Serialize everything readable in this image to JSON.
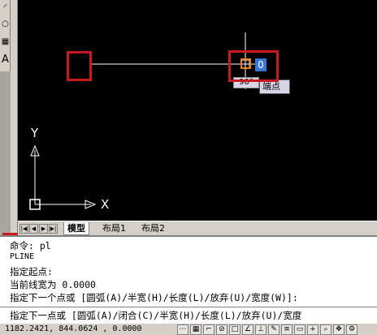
{
  "tools": [
    {
      "icon": "arc-tool-icon",
      "glyph": "◜"
    },
    {
      "icon": "circle-tool-icon",
      "glyph": "○"
    },
    {
      "icon": "hatch-tool-icon",
      "glyph": "▦"
    },
    {
      "icon": "text-tool-icon",
      "glyph": "A"
    }
  ],
  "canvas": {
    "angle_tooltip": "90°",
    "snap_tooltip": "端点",
    "input_value": "0",
    "axis_x": "X",
    "axis_y": "Y"
  },
  "tabs": {
    "nav_buttons": [
      "|◀",
      "◀",
      "▶",
      "▶|"
    ],
    "model": "模型",
    "layout1": "布局1",
    "layout2": "布局2"
  },
  "command_history": [
    "命令: pl",
    "PLINE",
    "指定起点:",
    "当前线宽为 0.0000",
    "指定下一个点或 [圆弧(A)/半宽(H)/长度(L)/放弃(U)/宽度(W)]:"
  ],
  "command_prompt": "指定下一点或 [圆弧(A)/闭合(C)/半宽(H)/长度(L)/放弃(U)/宽度",
  "status": {
    "coordinates": "1182.2421, 844.0624 , 0.0000",
    "buttons": [
      "snap",
      "grid",
      "ortho",
      "polar",
      "osnap",
      "otrack",
      "ducs",
      "dyn",
      "lwt",
      "model"
    ]
  },
  "colors": {
    "highlight_red": "#c8191e",
    "snap_marker": "#f08020",
    "canvas_bg": "#000000"
  }
}
